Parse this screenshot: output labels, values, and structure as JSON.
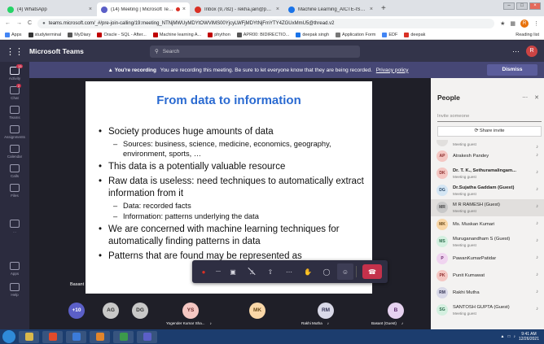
{
  "browser": {
    "tabs": [
      {
        "title": "(4) WhatsApp",
        "color": "#25d366",
        "active": false
      },
      {
        "title": "(14) Meeting | Microsoft Teams",
        "color": "#5b5fc7",
        "active": true,
        "recording": true
      },
      {
        "title": "Inbox (9,782) - rekha.jain@poornima.org",
        "color": "#d93025",
        "active": false
      },
      {
        "title": "Machine Learning_AICTE-ISTE-...",
        "color": "#1a73e8",
        "active": false
      }
    ],
    "new_tab": "+",
    "nav": {
      "back": "←",
      "forward": "→",
      "reload": "C"
    },
    "url": "teams.microsoft.com/_#/pre-join-calling/19:meeting_NTNjMWUyMDYtOWVlMS00YjcyLWFjMDYtNjFmYTY4ZGUxMmU5@thread.v2",
    "profile_initial": "R",
    "bookmarks": [
      {
        "label": "Apps",
        "color": "#4285f4"
      },
      {
        "label": "studyterminal",
        "color": "#333333"
      },
      {
        "label": "MyDiary",
        "color": "#555555"
      },
      {
        "label": "Oracle - SQL - After...",
        "color": "#c00000"
      },
      {
        "label": "Machine learning A...",
        "color": "#c00000"
      },
      {
        "label": "phython",
        "color": "#c00000"
      },
      {
        "label": "APR00: BIDIRECTIO...",
        "color": "#555555"
      },
      {
        "label": "deepak singh",
        "color": "#1a73e8"
      },
      {
        "label": "Application Form",
        "color": "#777777"
      },
      {
        "label": "EDF",
        "color": "#4285f4"
      },
      {
        "label": "deepak",
        "color": "#d93025"
      }
    ],
    "reading_list": "Reading list"
  },
  "teams": {
    "app_title": "Microsoft Teams",
    "search_placeholder": "Search",
    "header_avatar": "R",
    "rail": [
      {
        "label": "Activity",
        "badge": "13"
      },
      {
        "label": "Chat",
        "badge": "2"
      },
      {
        "label": "Teams",
        "badge": ""
      },
      {
        "label": "Assignments",
        "badge": ""
      },
      {
        "label": "Calendar",
        "badge": ""
      },
      {
        "label": "Calls",
        "badge": ""
      },
      {
        "label": "Files",
        "badge": ""
      },
      {
        "label": "...",
        "badge": ""
      },
      {
        "label": "Apps",
        "badge": ""
      },
      {
        "label": "Help",
        "badge": ""
      }
    ],
    "recording_banner": {
      "strong": "You're recording",
      "text": "You are recording this meeting. Be sure to let everyone know that they are being recorded.",
      "link": "Privacy policy",
      "dismiss": "Dismiss"
    },
    "presenter": "Basant (Guest)",
    "slide": {
      "title": "From data to information",
      "bullets": [
        {
          "level": 1,
          "text": "Society produces huge amounts of data"
        },
        {
          "level": 2,
          "text": "Sources: business, science, medicine, economics, geography, environment, sports, …"
        },
        {
          "level": 1,
          "text": "This data is a potentially valuable resource"
        },
        {
          "level": 1,
          "text": "Raw data is useless: need techniques to automatically extract information from it"
        },
        {
          "level": 2,
          "text": "Data: recorded facts"
        },
        {
          "level": 2,
          "text": "Information: patterns underlying the data"
        },
        {
          "level": 1,
          "text": "We are concerned with machine learning techniques for automatically finding patterns in data"
        },
        {
          "level": 1,
          "text": "Patterns that are found may be represented as"
        }
      ]
    },
    "strip": [
      {
        "initials": "+10",
        "bg": "#5b5fc7",
        "fg": "#ffffff",
        "name": ""
      },
      {
        "initials": "AG",
        "bg": "#c8c8c8",
        "fg": "#333333",
        "name": ""
      },
      {
        "initials": "DG",
        "bg": "#c8c8c8",
        "fg": "#333333",
        "name": ""
      },
      {
        "initials": "YS",
        "bg": "#f4c7c3",
        "fg": "#6b2b2b",
        "name": "Yogender Kumar Sha..."
      },
      {
        "initials": "MK",
        "bg": "#f9d7a8",
        "fg": "#6b4b1b",
        "name": ""
      },
      {
        "initials": "RM",
        "bg": "#d9d9e8",
        "fg": "#333355",
        "name": "Rakhi Mutha"
      },
      {
        "initials": "B",
        "bg": "#e6d2f0",
        "fg": "#5b2b6b",
        "name": "Basant (Guest)"
      }
    ],
    "people_panel": {
      "title": "People",
      "invite_placeholder": "Invite someone",
      "share_invite": "Share invite",
      "participants": [
        {
          "initials": "",
          "name": "",
          "role": "Meeting guest",
          "bg": "#e1dfdd",
          "fg": "#555555",
          "bold": false
        },
        {
          "initials": "AP",
          "name": "Atrakesh Pandey",
          "role": "",
          "bg": "#f4c7c3",
          "fg": "#8b2b2b",
          "bold": false
        },
        {
          "initials": "DK",
          "name": "Dr. T. K., Sethuramalingam...",
          "role": "Meeting guest",
          "bg": "#f4c7c3",
          "fg": "#8b2b2b",
          "bold": true
        },
        {
          "initials": "DG",
          "name": "Dr.Sujatha Gaddam (Guest)",
          "role": "Meeting guest",
          "bg": "#d4e6f4",
          "fg": "#2b4b6b",
          "bold": true
        },
        {
          "initials": "MR",
          "name": "M R RAMESH (Guest)",
          "role": "Meeting guest",
          "bg": "#c8c8c8",
          "fg": "#444444",
          "bold": false
        },
        {
          "initials": "MK",
          "name": "Ms. Muskan Kumari",
          "role": "",
          "bg": "#f9d7a8",
          "fg": "#6b4b1b",
          "bold": false
        },
        {
          "initials": "MS",
          "name": "Muruganandham S (Guest)",
          "role": "Meeting guest",
          "bg": "#d4f0e0",
          "fg": "#2b6b4b",
          "bold": false
        },
        {
          "initials": "P",
          "name": "PawanKumarPatidar",
          "role": "",
          "bg": "#f0d4f0",
          "fg": "#6b2b6b",
          "bold": false
        },
        {
          "initials": "PK",
          "name": "Punit Kumawat",
          "role": "",
          "bg": "#f4c7c3",
          "fg": "#8b2b2b",
          "bold": false
        },
        {
          "initials": "RM",
          "name": "Rakhi Mutha",
          "role": "",
          "bg": "#d9d9e8",
          "fg": "#333355",
          "bold": false
        },
        {
          "initials": "SG",
          "name": "SANTOSH GUPTA (Guest)",
          "role": "Meeting guest",
          "bg": "#d4f0e0",
          "fg": "#2b6b4b",
          "bold": false
        }
      ]
    }
  },
  "taskbar": {
    "apps": [
      {
        "color": "#d9b94b"
      },
      {
        "color": "#e24b2b"
      },
      {
        "color": "#3c7bd8"
      },
      {
        "color": "#e2852b"
      },
      {
        "color": "#3c9a4b"
      },
      {
        "color": "#5b5fc7"
      }
    ],
    "time": "9:41 AM",
    "date": "12/26/2021"
  },
  "colors": {
    "teams_header": "#33344a",
    "banner": "#464775",
    "slide_title": "#2a6ad1",
    "hangup": "#c4314b",
    "accent": "#5b5fc7"
  }
}
